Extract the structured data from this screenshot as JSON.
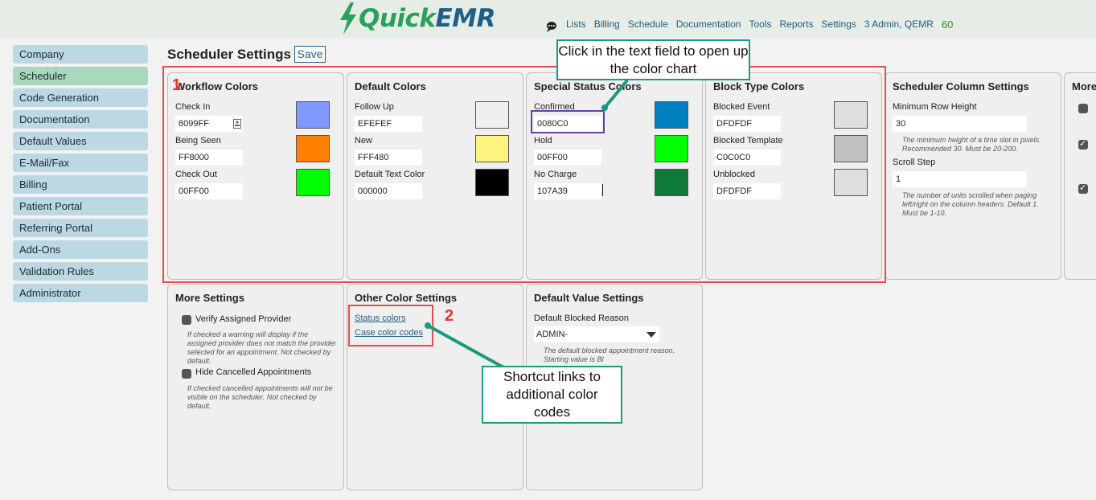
{
  "app": {
    "logo_quick": "Quick",
    "logo_emr": "EMR"
  },
  "nav": {
    "items": [
      "Lists",
      "Billing",
      "Schedule",
      "Documentation",
      "Tools",
      "Reports",
      "Settings",
      "3 Admin, QEMR"
    ],
    "count": "60"
  },
  "sidebar": {
    "items": [
      "Company",
      "Scheduler",
      "Code Generation",
      "Documentation",
      "Default Values",
      "E-Mail/Fax",
      "Billing",
      "Patient Portal",
      "Referring Portal",
      "Add-Ons",
      "Validation Rules",
      "Administrator"
    ]
  },
  "page": {
    "title": "Scheduler Settings",
    "save_label": "Save"
  },
  "workflow": {
    "title": "Workflow Colors",
    "rows": [
      {
        "label": "Check In",
        "value": "8099FF",
        "color": "#8099FF"
      },
      {
        "label": "Being Seen",
        "value": "FF8000",
        "color": "#FF8000"
      },
      {
        "label": "Check Out",
        "value": "00FF00",
        "color": "#00FF00"
      }
    ]
  },
  "default_colors": {
    "title": "Default Colors",
    "rows": [
      {
        "label": "Follow Up",
        "value": "EFEFEF",
        "color": "#EFEFEF"
      },
      {
        "label": "New",
        "value": "FFF480",
        "color": "#FFF480"
      },
      {
        "label": "Default Text Color",
        "value": "000000",
        "color": "#000000"
      }
    ]
  },
  "special_status": {
    "title": "Special Status Colors",
    "rows": [
      {
        "label": "Confirmed",
        "value": "0080C0",
        "color": "#0080C0"
      },
      {
        "label": "Hold",
        "value": "00FF00",
        "color": "#00FF00"
      },
      {
        "label": "No Charge",
        "value": "107A39",
        "color": "#107A39"
      }
    ]
  },
  "block_type": {
    "title": "Block Type Colors",
    "rows": [
      {
        "label": "Blocked Event",
        "value": "DFDFDF",
        "color": "#DFDFDF"
      },
      {
        "label": "Blocked Template",
        "value": "C0C0C0",
        "color": "#C0C0C0"
      },
      {
        "label": "Unblocked",
        "value": "DFDFDF",
        "color": "#DFDFDF"
      }
    ]
  },
  "column_settings": {
    "title": "Scheduler Column Settings",
    "min_row_label": "Minimum Row Height",
    "min_row_value": "30",
    "min_row_help": "The minimum height of a time slot in pixels. Recommended 30. Must be 20-200.",
    "scroll_label": "Scroll Step",
    "scroll_value": "1",
    "scroll_help": "The number of units scrolled when paging left/right on the column headers. Default 1. Must be 1-10."
  },
  "more_partial": {
    "title": "More"
  },
  "more_settings": {
    "title": "More Settings",
    "verify_label": "Verify Assigned Provider",
    "verify_help": "If checked a warning will display if the assigned provider does not match the provider selected for an appointment. Not checked by default.",
    "hide_label": "Hide Cancelled Appointments",
    "hide_help": "If checked cancelled appointments will not be visible on the scheduler. Not checked by default."
  },
  "other_colors": {
    "title": "Other Color Settings",
    "links": [
      "Status colors",
      "Case color codes"
    ]
  },
  "default_value": {
    "title": "Default Value Settings",
    "blocked_label": "Default Blocked Reason",
    "blocked_value": "ADMIN-",
    "blocked_help": "The default blocked appointment reason. Starting value is Bl"
  },
  "annotations": {
    "callout_top": "Click in the text field to open up the color chart",
    "callout_bottom": "Shortcut links to additional color codes",
    "num1": "1",
    "num2": "2"
  }
}
